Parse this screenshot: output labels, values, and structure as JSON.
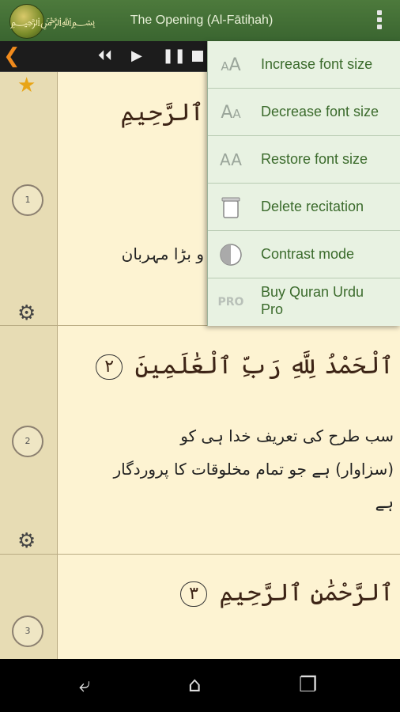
{
  "app": {
    "title": "The Opening (Al-Fātiḥah)",
    "logo_icon": "quran-logo-icon"
  },
  "player": {
    "back_icon": "chevron-left-icon",
    "controls": [
      "rewind-icon",
      "play-icon",
      "pause-icon",
      "stop-icon"
    ]
  },
  "menu": {
    "items": [
      {
        "label": "Increase font size",
        "icon": "increase-font-icon"
      },
      {
        "label": "Decrease font size",
        "icon": "decrease-font-icon"
      },
      {
        "label": "Restore font size",
        "icon": "restore-font-icon"
      },
      {
        "label": "Delete recitation",
        "icon": "trash-icon"
      },
      {
        "label": "Contrast mode",
        "icon": "contrast-icon"
      },
      {
        "label": "Buy Quran Urdu Pro",
        "icon": "pro-icon"
      }
    ]
  },
  "verses": [
    {
      "number": "1",
      "arabic": "ٱلرَّحِيمِ",
      "urdu": "و بڑا مہربان"
    },
    {
      "number": "2",
      "arabic": "ٱلْحَمْدُ لِلَّهِ رَبِّ ٱلْعَٰلَمِينَ",
      "marker": "٢",
      "urdu_lines": [
        "سب طرح کی تعریف خدا ہی کو",
        "(سزاوار) ہے جو تمام مخلوقات کا پروردگار",
        "ہے"
      ]
    },
    {
      "number": "3",
      "arabic": "ٱلرَّحْمَٰنِ ٱلرَّحِيمِ",
      "marker": "٣"
    }
  ],
  "navbar": {
    "icons": [
      "back-nav-icon",
      "home-nav-icon",
      "recents-nav-icon"
    ]
  }
}
